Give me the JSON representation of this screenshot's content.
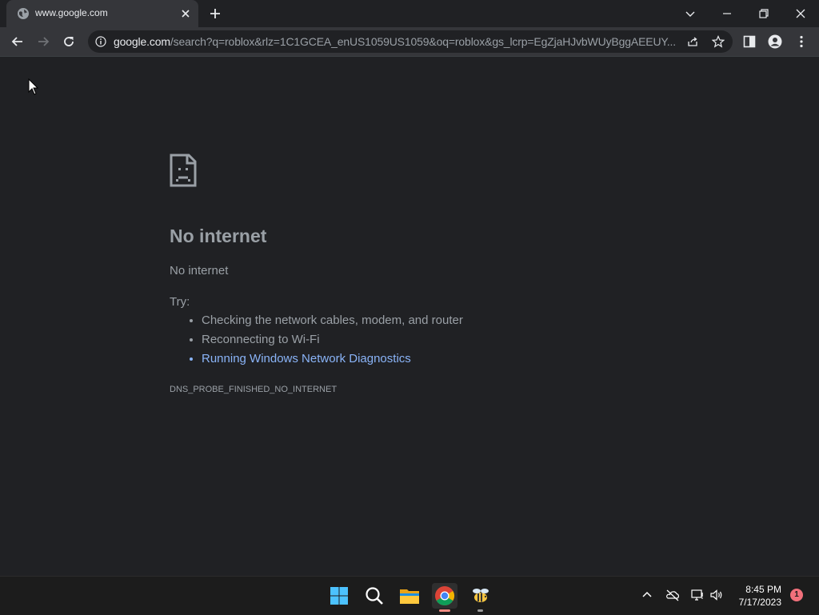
{
  "browser": {
    "tab": {
      "title": "www.google.com",
      "favicon": "globe-icon"
    },
    "url": {
      "host": "google.com",
      "path": "/search?q=roblox&rlz=1C1GCEA_enUS1059US1059&oq=roblox&gs_lcrp=EgZjaHJvbWUyBggAEEUY..."
    }
  },
  "error_page": {
    "title": "No internet",
    "subtitle": "No internet",
    "try_label": "Try:",
    "suggestions": [
      "Checking the network cables, modem, and router",
      "Reconnecting to Wi-Fi",
      "Running Windows Network Diagnostics"
    ],
    "error_code": "DNS_PROBE_FINISHED_NO_INTERNET"
  },
  "taskbar": {
    "apps": [
      "start-icon",
      "search-icon",
      "file-explorer-icon",
      "chrome-icon",
      "bee-app-icon"
    ],
    "clock": {
      "time": "8:45 PM",
      "date": "7/17/2023"
    },
    "notification_count": "1"
  },
  "colors": {
    "page_bg": "#202124",
    "toolbar_bg": "#35363a",
    "text": "#9aa0a6",
    "link": "#8ab4f8"
  }
}
